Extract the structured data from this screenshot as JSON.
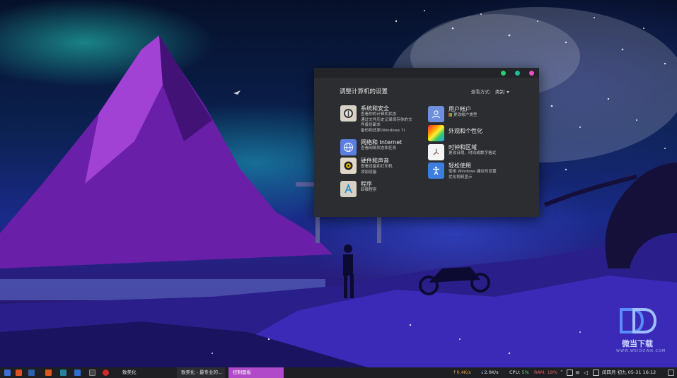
{
  "window": {
    "heading": "调整计算机的设置",
    "view_by_label": "查看方式:",
    "view_by_value": "类别",
    "controls": {
      "minimize_color": "#2ecc71",
      "maximize_color": "#1abc9c",
      "close_color": "#e84fc0"
    }
  },
  "categories": [
    {
      "title": "系统和安全",
      "links": [
        "查看你的计算机状态",
        "通过文件历史记录保存你的文",
        "件备份副本",
        "备份和还原(Windows 7)"
      ],
      "icon": "system-security-icon"
    },
    {
      "title": "网络和 Internet",
      "links": [
        "查看网络状态和任务"
      ],
      "icon": "network-internet-icon"
    },
    {
      "title": "硬件和声音",
      "links": [
        "查看设备和打印机",
        "添加设备"
      ],
      "icon": "hardware-sound-icon"
    },
    {
      "title": "程序",
      "links": [
        "卸载程序"
      ],
      "icon": "programs-icon"
    },
    {
      "title": "用户帐户",
      "links": [
        "更改帐户类型"
      ],
      "icon": "user-accounts-icon"
    },
    {
      "title": "外观和个性化",
      "links": [],
      "icon": "appearance-icon"
    },
    {
      "title": "时钟和区域",
      "links": [
        "更改日期、时间或数字格式"
      ],
      "icon": "clock-region-icon"
    },
    {
      "title": "轻松使用",
      "links": [
        "使用 Windows 建议的设置",
        "优化视频显示"
      ],
      "icon": "ease-of-access-icon"
    }
  ],
  "taskbar": {
    "tasks": [
      "致美化",
      "致美化 - 最专业的...",
      "控制面板"
    ],
    "active_task_color": "#b04ac8",
    "upload": "0.4K/s",
    "download": "2.0K/s",
    "cpu_label": "CPU:",
    "cpu_value": "5%",
    "ram_label": "RAM:",
    "ram_value": "18%",
    "clock": "闰四月 初九 05-31 16:12"
  },
  "watermark": {
    "brand": "微当下载",
    "site": "WWW.WEIDOWN.COM"
  }
}
